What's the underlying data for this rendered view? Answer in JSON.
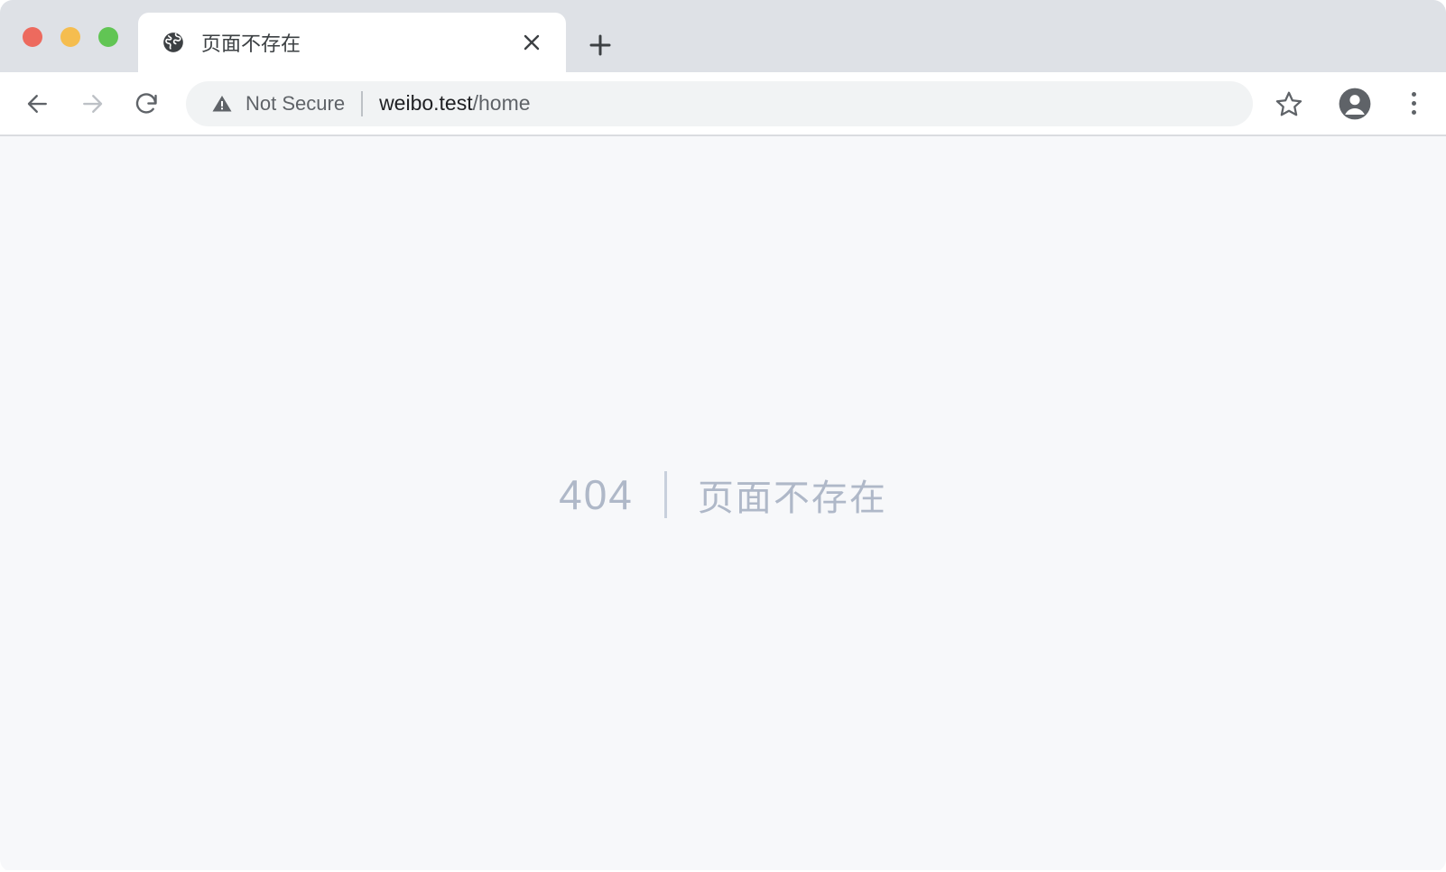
{
  "window": {
    "traffic_lights": [
      {
        "name": "close",
        "color": "#ED6A5E"
      },
      {
        "name": "minimize",
        "color": "#F5BD4F"
      },
      {
        "name": "maximize",
        "color": "#61C554"
      }
    ]
  },
  "tab_strip": {
    "tabs": [
      {
        "title": "页面不存在",
        "favicon": "globe-icon",
        "close_icon": "close-icon",
        "active": true
      }
    ],
    "new_tab_icon": "plus-icon"
  },
  "toolbar": {
    "back_icon": "arrow-left-icon",
    "forward_icon": "arrow-right-icon",
    "reload_icon": "reload-icon",
    "omnibox": {
      "security_icon": "warning-triangle-icon",
      "security_label": "Not Secure",
      "url_host": "weibo.test",
      "url_path": "/home"
    },
    "bookmark_icon": "star-icon",
    "profile_icon": "account-avatar-icon",
    "menu_icon": "three-dot-menu-icon"
  },
  "page": {
    "error_code": "404",
    "error_message": "页面不存在",
    "background_color": "#F7F8FA",
    "text_color": "#AFB8C8"
  }
}
